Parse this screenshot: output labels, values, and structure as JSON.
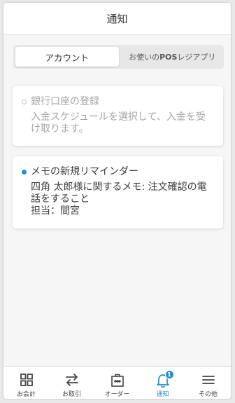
{
  "header": {
    "title": "通知"
  },
  "segment": {
    "tab_account": "アカウント",
    "tab_pos_prefix": "お使いの",
    "tab_pos_bold": "POS",
    "tab_pos_suffix": "レジアプリ"
  },
  "cards": [
    {
      "title": "銀行口座の登録",
      "body": "入金スケジュールを選択して、入金を受け取ります。",
      "read": true
    },
    {
      "title": "メモの新規リマインダー",
      "body_line1": "四角 太郎様に関するメモ: 注文確認の電話をすること",
      "body_line2": "担当：間宮",
      "read": false
    }
  ],
  "tabbar": {
    "items": [
      {
        "label": "お会計",
        "icon": "grid-icon"
      },
      {
        "label": "お取引",
        "icon": "swap-arrows-icon"
      },
      {
        "label": "オーダー",
        "icon": "order-bag-icon"
      },
      {
        "label": "通知",
        "icon": "bell-icon",
        "badge": "1",
        "active": true
      },
      {
        "label": "その他",
        "icon": "menu-icon"
      }
    ]
  },
  "colors": {
    "accent": "#2a8ec8",
    "muted_text": "#a6a6a6"
  }
}
